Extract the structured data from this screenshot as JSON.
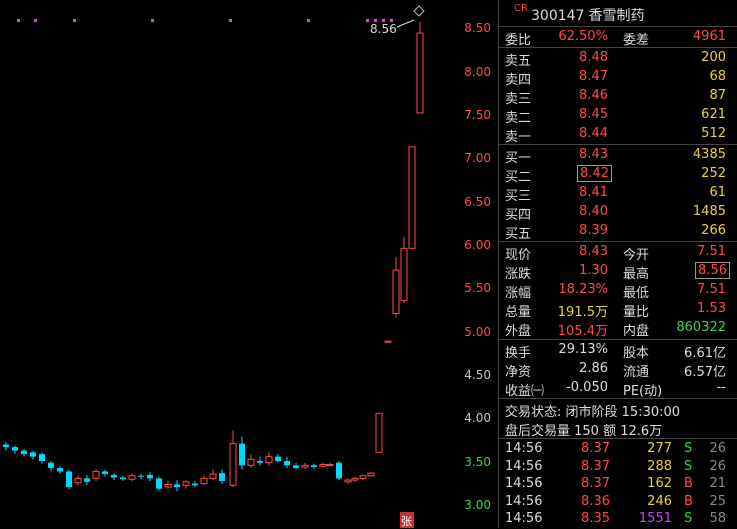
{
  "stock": {
    "tag": "CR",
    "code": "300147",
    "name": "香雪制药"
  },
  "chart": {
    "y_ticks": [
      "8.50",
      "8.00",
      "7.50",
      "7.00",
      "6.50",
      "6.00",
      "5.50",
      "5.00",
      "4.50",
      "4.00",
      "3.50",
      "3.00"
    ],
    "high_label": "8.56",
    "zhang_badge": "张"
  },
  "ratio": {
    "wb_label": "委比",
    "wb_value": "62.50%",
    "wc_label": "委差",
    "wc_value": "4961"
  },
  "asks": [
    {
      "label": "卖五",
      "price": "8.48",
      "vol": "200"
    },
    {
      "label": "卖四",
      "price": "8.47",
      "vol": "68"
    },
    {
      "label": "卖三",
      "price": "8.46",
      "vol": "87"
    },
    {
      "label": "卖二",
      "price": "8.45",
      "vol": "621"
    },
    {
      "label": "卖一",
      "price": "8.44",
      "vol": "512"
    }
  ],
  "bids": [
    {
      "label": "买一",
      "price": "8.43",
      "vol": "4385"
    },
    {
      "label": "买二",
      "price": "8.42",
      "vol": "252"
    },
    {
      "label": "买三",
      "price": "8.41",
      "vol": "61"
    },
    {
      "label": "买四",
      "price": "8.40",
      "vol": "1485"
    },
    {
      "label": "买五",
      "price": "8.39",
      "vol": "266"
    }
  ],
  "quote": [
    {
      "l1": "现价",
      "v1": "8.43",
      "c1": "red",
      "l2": "今开",
      "v2": "7.51",
      "c2": "red"
    },
    {
      "l1": "涨跌",
      "v1": "1.30",
      "c1": "red",
      "l2": "最高",
      "v2": "8.56",
      "c2": "red"
    },
    {
      "l1": "涨幅",
      "v1": "18.23%",
      "c1": "red",
      "l2": "最低",
      "v2": "7.51",
      "c2": "red"
    },
    {
      "l1": "总量",
      "v1": "191.5万",
      "c1": "yellow",
      "l2": "量比",
      "v2": "1.53",
      "c2": "red"
    },
    {
      "l1": "外盘",
      "v1": "105.4万",
      "c1": "red",
      "l2": "内盘",
      "v2": "860322",
      "c2": "green"
    }
  ],
  "fund": [
    {
      "l1": "换手",
      "v1": "29.13%",
      "l2": "股本",
      "v2": "6.61亿"
    },
    {
      "l1": "净资",
      "v1": "2.86",
      "l2": "流通",
      "v2": "6.57亿"
    },
    {
      "l1": "收益㈠",
      "v1": "-0.050",
      "l2": "PE(动)",
      "v2": "--"
    }
  ],
  "status": {
    "line1": "交易状态: 闭市阶段 15:30:00",
    "line2": "盘后交易量 150 额 12.6万"
  },
  "ticks": [
    {
      "time": "14:56",
      "price": "8.37",
      "vol": "277",
      "side": "S",
      "count": "26"
    },
    {
      "time": "14:56",
      "price": "8.37",
      "vol": "288",
      "side": "S",
      "count": "26"
    },
    {
      "time": "14:56",
      "price": "8.37",
      "vol": "162",
      "side": "B",
      "count": "21"
    },
    {
      "time": "14:56",
      "price": "8.36",
      "vol": "246",
      "side": "B",
      "count": "25"
    },
    {
      "time": "14:56",
      "price": "8.35",
      "vol": "1551",
      "side": "S",
      "count": "58"
    }
  ],
  "colors": {
    "up": "#ff4a4a",
    "down": "#00d8ff",
    "magenta": "#e040e0"
  }
}
